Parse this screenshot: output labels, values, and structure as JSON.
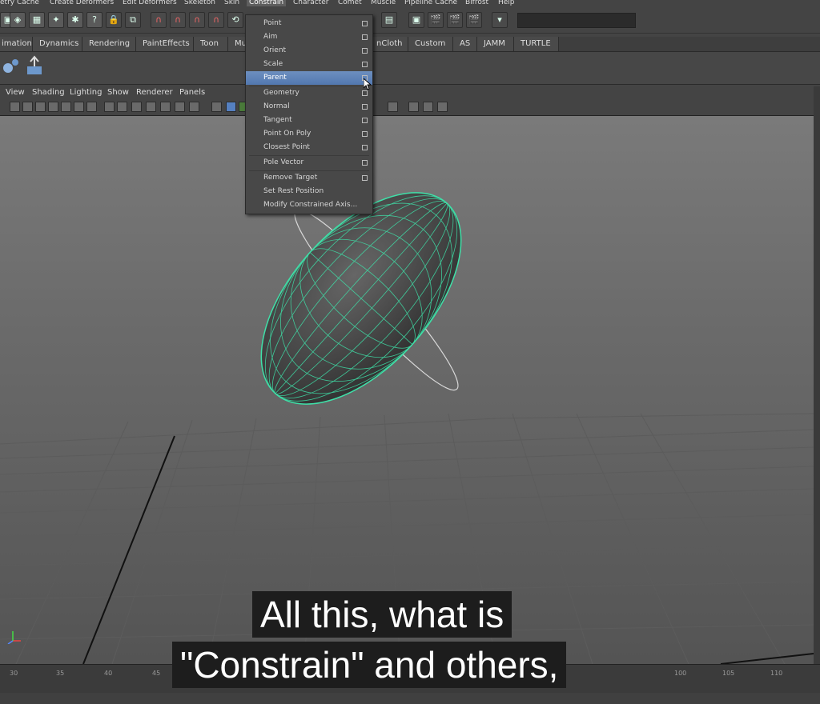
{
  "menubar": {
    "items": [
      "etry Cache",
      "Create Deformers",
      "Edit Deformers",
      "Skeleton",
      "Skin",
      "Constrain",
      "Character",
      "Comet",
      "Muscle",
      "Pipeline Cache",
      "Bifrost",
      "Help"
    ],
    "active": "Constrain"
  },
  "shelf_tabs": [
    "imation",
    "Dynamics",
    "Rendering",
    "PaintEffects",
    "Toon",
    "Mu",
    "nCloth",
    "Custom",
    "AS",
    "JAMM",
    "TURTLE"
  ],
  "panel_menu": [
    "View",
    "Shading",
    "Lighting",
    "Show",
    "Renderer",
    "Panels"
  ],
  "constrain_menu": {
    "items": [
      {
        "label": "Point",
        "option": true
      },
      {
        "label": "Aim",
        "option": true
      },
      {
        "label": "Orient",
        "option": true
      },
      {
        "label": "Scale",
        "option": true
      },
      {
        "label": "Parent",
        "option": true,
        "highlighted": true
      },
      {
        "label": "Geometry",
        "option": true
      },
      {
        "label": "Normal",
        "option": true
      },
      {
        "label": "Tangent",
        "option": true
      },
      {
        "label": "Point On Poly",
        "option": true
      },
      {
        "label": "Closest Point",
        "option": true
      },
      {
        "label": "Pole Vector",
        "option": true
      },
      {
        "label": "Remove Target",
        "option": true
      },
      {
        "label": "Set Rest Position",
        "option": false
      },
      {
        "label": "Modify Constrained Axis...",
        "option": false
      }
    ]
  },
  "timeline_ticks": [
    "30",
    "35",
    "40",
    "45",
    "100",
    "105",
    "110"
  ],
  "subtitles": {
    "line1": "All this, what is",
    "line2": "\"Constrain\" and others,"
  },
  "colors": {
    "wireframe": "#3fe0a8",
    "menu_highlight": "#5a80b8"
  },
  "icons": [
    "question-icon",
    "magnet-icon",
    "render-icon",
    "clapper-icon"
  ]
}
